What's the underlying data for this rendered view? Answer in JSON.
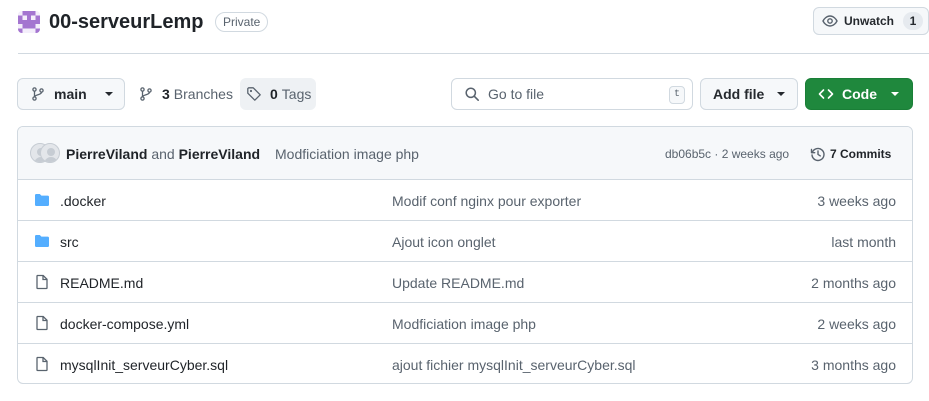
{
  "repo": {
    "name": "00-serveurLemp",
    "visibility": "Private"
  },
  "watch": {
    "label": "Unwatch",
    "count": "1"
  },
  "toolbar": {
    "branch": "main",
    "branches_count": "3",
    "branches_label": "Branches",
    "tags_count": "0",
    "tags_label": "Tags",
    "search_placeholder": "Go to file",
    "search_shortcut": "t",
    "add_file_label": "Add file",
    "code_label": "Code"
  },
  "latest_commit": {
    "author1": "PierreViland",
    "conjunction": "and",
    "author2": "PierreViland",
    "message": "Modficiation image php",
    "hash_age": "db06b5c · 2 weeks ago",
    "commits_label": "7 Commits"
  },
  "files": [
    {
      "type": "folder",
      "name": ".docker",
      "commit": "Modif conf nginx pour exporter",
      "age": "3 weeks ago"
    },
    {
      "type": "folder",
      "name": "src",
      "commit": "Ajout icon onglet",
      "age": "last month"
    },
    {
      "type": "file",
      "name": "README.md",
      "commit": "Update README.md",
      "age": "2 months ago"
    },
    {
      "type": "file",
      "name": "docker-compose.yml",
      "commit": "Modficiation image php",
      "age": "2 weeks ago"
    },
    {
      "type": "file",
      "name": "mysqlInit_serveurCyber.sql",
      "commit": "ajout fichier mysqlInit_serveurCyber.sql",
      "age": "3 months ago"
    }
  ],
  "colors": {
    "accent_green": "#1f883d",
    "folder_blue": "#54aeff",
    "avatar_purple": "#a475d0"
  },
  "icons": {
    "repo_avatar": "identicon-purple",
    "watch": "eye-icon",
    "branch": "git-branch-icon",
    "tag": "tag-icon",
    "search": "search-icon",
    "code": "code-icon",
    "history": "history-icon",
    "folder": "folder-icon",
    "file": "file-icon"
  }
}
